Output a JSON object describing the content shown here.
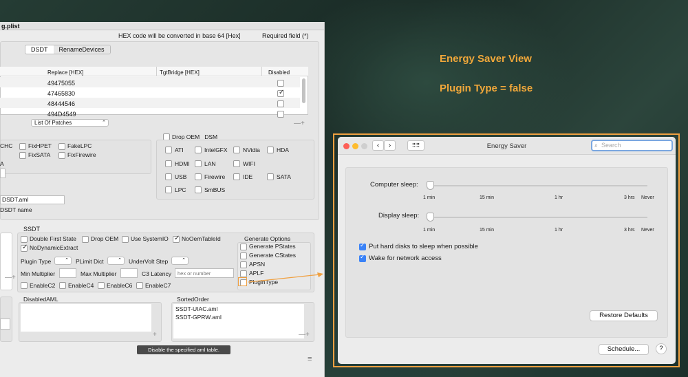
{
  "window": {
    "title": "g.plist",
    "hex_notice": "HEX code will be converted in base 64 [Hex]",
    "required_notice": "Required field (*)"
  },
  "tabs": [
    "DSDT",
    "RenameDevices"
  ],
  "patch_table": {
    "headers": [
      "Replace [HEX]",
      "TgtBridge [HEX]",
      "Disabled"
    ],
    "rows": [
      {
        "replace": "49475055",
        "disabled": false
      },
      {
        "replace": "47465830",
        "disabled": true
      },
      {
        "replace": "48444546",
        "disabled": false
      },
      {
        "replace": "494D4549",
        "disabled": false
      }
    ],
    "dropdown": "List Of Patches",
    "controls": "—+"
  },
  "dsdt_fixes": {
    "chc": "CHC",
    "items": [
      "FixHPET",
      "FakeLPC",
      "FixSATA",
      "FixFirewire"
    ],
    "a": "A",
    "name_value": "DSDT.aml",
    "name_label": "DSDT name"
  },
  "drop_oem": {
    "label": "Drop OEM _DSM",
    "items": [
      "ATI",
      "IntelGFX",
      "NVidia",
      "HDA",
      "HDMI",
      "LAN",
      "WIFI",
      "USB",
      "Firewire",
      "IDE",
      "SATA",
      "LPC",
      "SmBUS"
    ]
  },
  "ssdt": {
    "title": "SSDT",
    "row1": [
      "Double First State",
      "Drop OEM",
      "Use SystemIO",
      "NoOemTableId"
    ],
    "no_dynamic": "NoDynamicExtract",
    "plugin_type": "Plugin Type",
    "plimit": "PLimit Dict",
    "undervolt": "UnderVolt Step",
    "min_mult": "Min Multiplier",
    "max_mult": "Max Multiplier",
    "c3": "C3 Latency",
    "c3_placeholder": "hex or number",
    "enable": [
      "EnableC2",
      "EnableC4",
      "EnableC6",
      "EnableC7"
    ],
    "gen_title": "Generate Options",
    "gen_items": [
      "Generate PStates",
      "Generate CStates",
      "APSN",
      "APLF",
      "PluginType"
    ],
    "left_controls": "—+"
  },
  "disabled_aml": {
    "title": "DisabledAML",
    "controls": "+"
  },
  "sorted_order": {
    "title": "SortedOrder",
    "items": [
      "SSDT-UIAC.aml",
      "SSDT-GPRW.aml"
    ],
    "controls": "—+"
  },
  "tooltip": "Disable the specified aml table.",
  "annotations": {
    "line1": "Energy Saver View",
    "line2": "Plugin Type = false",
    "color": "#f0a040"
  },
  "energy_saver": {
    "title": "Energy Saver",
    "search_placeholder": "Search",
    "computer_sleep": "Computer sleep:",
    "display_sleep": "Display sleep:",
    "ticks": [
      "1 min",
      "15 min",
      "1 hr",
      "3 hrs",
      "Never"
    ],
    "computer_sleep_value": "1 min",
    "display_sleep_value": "1 min",
    "opt1": "Put hard disks to sleep when possible",
    "opt2": "Wake for network access",
    "restore": "Restore Defaults",
    "schedule": "Schedule...",
    "help": "?"
  }
}
